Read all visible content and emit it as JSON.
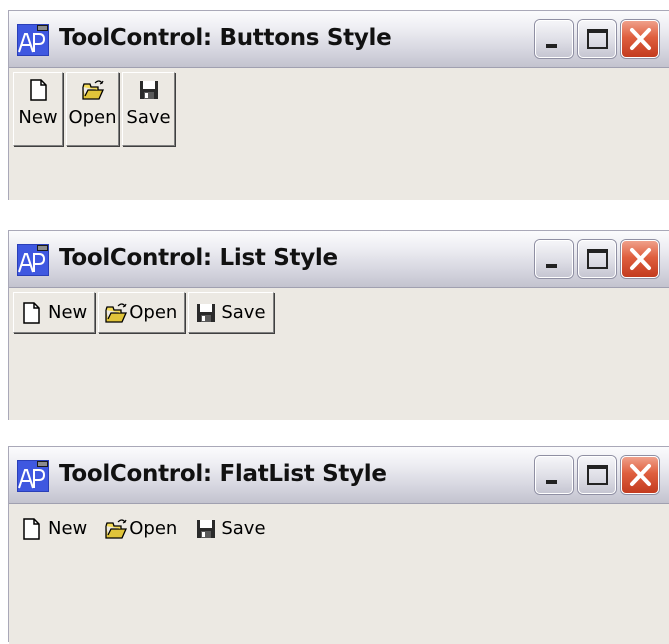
{
  "windows": [
    {
      "title": "ToolControl: Buttons Style",
      "style": "buttons",
      "buttons": [
        {
          "label": "New",
          "icon": "new-document-icon"
        },
        {
          "label": "Open",
          "icon": "open-folder-icon"
        },
        {
          "label": "Save",
          "icon": "save-disk-icon"
        }
      ]
    },
    {
      "title": "ToolControl: List Style",
      "style": "list",
      "buttons": [
        {
          "label": "New",
          "icon": "new-document-icon"
        },
        {
          "label": "Open",
          "icon": "open-folder-icon"
        },
        {
          "label": "Save",
          "icon": "save-disk-icon"
        }
      ]
    },
    {
      "title": "ToolControl: FlatList Style",
      "style": "flatlist",
      "buttons": [
        {
          "label": "New",
          "icon": "new-document-icon"
        },
        {
          "label": "Open",
          "icon": "open-folder-icon"
        },
        {
          "label": "Save",
          "icon": "save-disk-icon"
        }
      ]
    }
  ],
  "colors": {
    "client_bg": "#ece9e3",
    "close_button": "#d9533a",
    "folder_yellow": "#e0c43a",
    "disk_dark": "#2a2a2a"
  }
}
